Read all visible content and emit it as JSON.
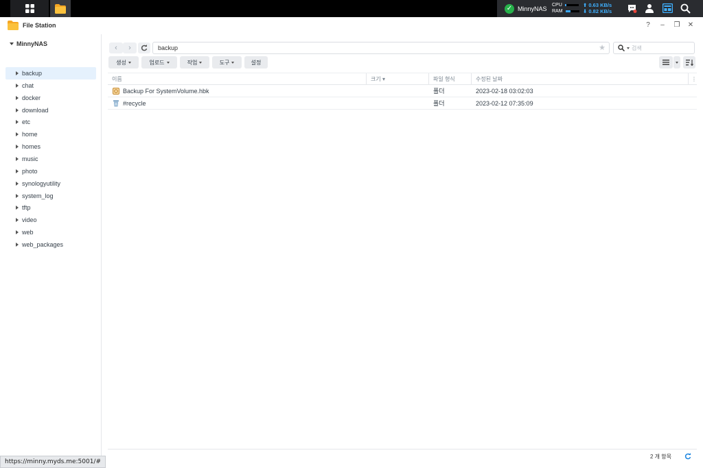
{
  "taskbar": {
    "apps": [
      "main-menu",
      "file-station"
    ],
    "nas_name": "MinnyNAS",
    "cpu_label": "CPU",
    "ram_label": "RAM",
    "cpu_usage": 0.1,
    "ram_usage": 0.35,
    "upload_rate": "0.63 KB/s",
    "download_rate": "0.82 KB/s",
    "icons": [
      "notification-icon",
      "user-icon",
      "widgets-icon",
      "search-icon"
    ],
    "accent": "#3fb0ff"
  },
  "window": {
    "title": "File Station",
    "controls": [
      "?",
      "–",
      "❐",
      "✕"
    ]
  },
  "sidebar": {
    "root": "MinnyNAS",
    "items": [
      "backup",
      "chat",
      "docker",
      "download",
      "etc",
      "home",
      "homes",
      "music",
      "photo",
      "synologyutility",
      "system_log",
      "tftp",
      "video",
      "web",
      "web_packages"
    ],
    "selected": "backup"
  },
  "toolbar": {
    "path": "backup",
    "search_placeholder": "검색",
    "buttons": [
      "생성",
      "업로드",
      "작업",
      "도구",
      "설정"
    ]
  },
  "table": {
    "columns": [
      "이름",
      "크기",
      "파일 형식",
      "수정된 날짜"
    ],
    "rows": [
      {
        "name": "Backup For SystemVolume.hbk",
        "size": "",
        "type": "폴더",
        "modified": "2023-02-18 03:02:03",
        "icon": "backup-file-icon"
      },
      {
        "name": "#recycle",
        "size": "",
        "type": "폴더",
        "modified": "2023-02-12 07:35:09",
        "icon": "recycle-bin-icon"
      }
    ]
  },
  "status": {
    "item_count": "2 개 항목"
  },
  "url_tooltip": "https://minny.myds.me:5001/#"
}
